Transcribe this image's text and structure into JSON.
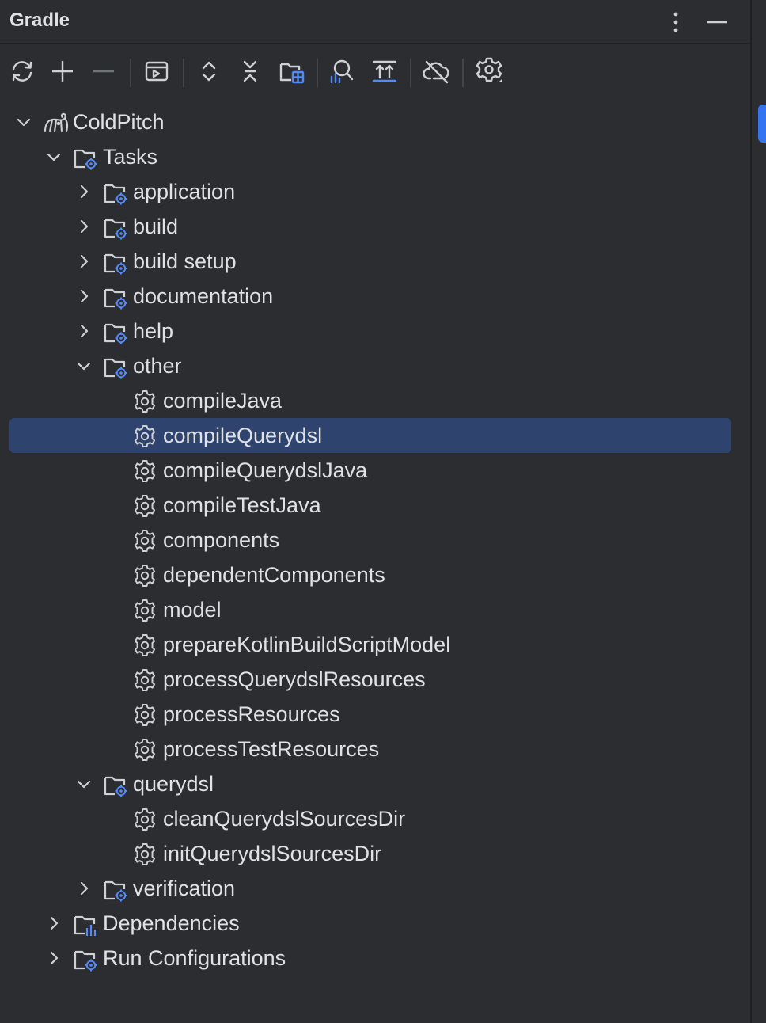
{
  "panel": {
    "title": "Gradle",
    "options_icon": "kebab-menu-icon",
    "minimize_icon": "minimize-icon"
  },
  "toolbar": [
    {
      "name": "reload-button",
      "icon": "sync-icon"
    },
    {
      "name": "add-button",
      "icon": "plus-icon"
    },
    {
      "name": "remove-button",
      "icon": "minus-icon"
    },
    {
      "name": "execute-task-button",
      "icon": "run-task-icon"
    },
    {
      "name": "expand-all-button",
      "icon": "expand-all-icon"
    },
    {
      "name": "collapse-all-button",
      "icon": "collapse-all-icon"
    },
    {
      "name": "group-modules-button",
      "icon": "group-modules-icon"
    },
    {
      "name": "analyze-dependencies-button",
      "icon": "analyze-icon"
    },
    {
      "name": "build-button",
      "icon": "upload-icon"
    },
    {
      "name": "offline-mode-button",
      "icon": "cloud-off-icon"
    },
    {
      "name": "settings-button",
      "icon": "gear-icon"
    }
  ],
  "tree": [
    {
      "label": "ColdPitch",
      "level": 0,
      "chevron": "down",
      "icon": "gradle-elephant-icon"
    },
    {
      "label": "Tasks",
      "level": 1,
      "chevron": "down",
      "icon": "task-folder-icon"
    },
    {
      "label": "application",
      "level": 2,
      "chevron": "right",
      "icon": "task-folder-icon"
    },
    {
      "label": "build",
      "level": 2,
      "chevron": "right",
      "icon": "task-folder-icon"
    },
    {
      "label": "build setup",
      "level": 2,
      "chevron": "right",
      "icon": "task-folder-icon"
    },
    {
      "label": "documentation",
      "level": 2,
      "chevron": "right",
      "icon": "task-folder-icon"
    },
    {
      "label": "help",
      "level": 2,
      "chevron": "right",
      "icon": "task-folder-icon"
    },
    {
      "label": "other",
      "level": 2,
      "chevron": "down",
      "icon": "task-folder-icon"
    },
    {
      "label": "compileJava",
      "level": 3,
      "chevron": "none",
      "icon": "task-gear-icon"
    },
    {
      "label": "compileQuerydsl",
      "level": 3,
      "chevron": "none",
      "icon": "task-gear-icon",
      "selected": true
    },
    {
      "label": "compileQuerydslJava",
      "level": 3,
      "chevron": "none",
      "icon": "task-gear-icon"
    },
    {
      "label": "compileTestJava",
      "level": 3,
      "chevron": "none",
      "icon": "task-gear-icon"
    },
    {
      "label": "components",
      "level": 3,
      "chevron": "none",
      "icon": "task-gear-icon"
    },
    {
      "label": "dependentComponents",
      "level": 3,
      "chevron": "none",
      "icon": "task-gear-icon"
    },
    {
      "label": "model",
      "level": 3,
      "chevron": "none",
      "icon": "task-gear-icon"
    },
    {
      "label": "prepareKotlinBuildScriptModel",
      "level": 3,
      "chevron": "none",
      "icon": "task-gear-icon"
    },
    {
      "label": "processQuerydslResources",
      "level": 3,
      "chevron": "none",
      "icon": "task-gear-icon"
    },
    {
      "label": "processResources",
      "level": 3,
      "chevron": "none",
      "icon": "task-gear-icon"
    },
    {
      "label": "processTestResources",
      "level": 3,
      "chevron": "none",
      "icon": "task-gear-icon"
    },
    {
      "label": "querydsl",
      "level": 2,
      "chevron": "down",
      "icon": "task-folder-icon"
    },
    {
      "label": "cleanQuerydslSourcesDir",
      "level": 3,
      "chevron": "none",
      "icon": "task-gear-icon"
    },
    {
      "label": "initQuerydslSourcesDir",
      "level": 3,
      "chevron": "none",
      "icon": "task-gear-icon"
    },
    {
      "label": "verification",
      "level": 2,
      "chevron": "right",
      "icon": "task-folder-icon"
    },
    {
      "label": "Dependencies",
      "level": 1,
      "chevron": "right",
      "icon": "dependencies-folder-icon"
    },
    {
      "label": "Run Configurations",
      "level": 1,
      "chevron": "right",
      "icon": "task-folder-icon"
    }
  ],
  "colors": {
    "background": "#2b2d30",
    "selection": "#2e436e",
    "accent": "#3574f0",
    "text": "#dfe1e5",
    "icon": "#ced0d6"
  }
}
